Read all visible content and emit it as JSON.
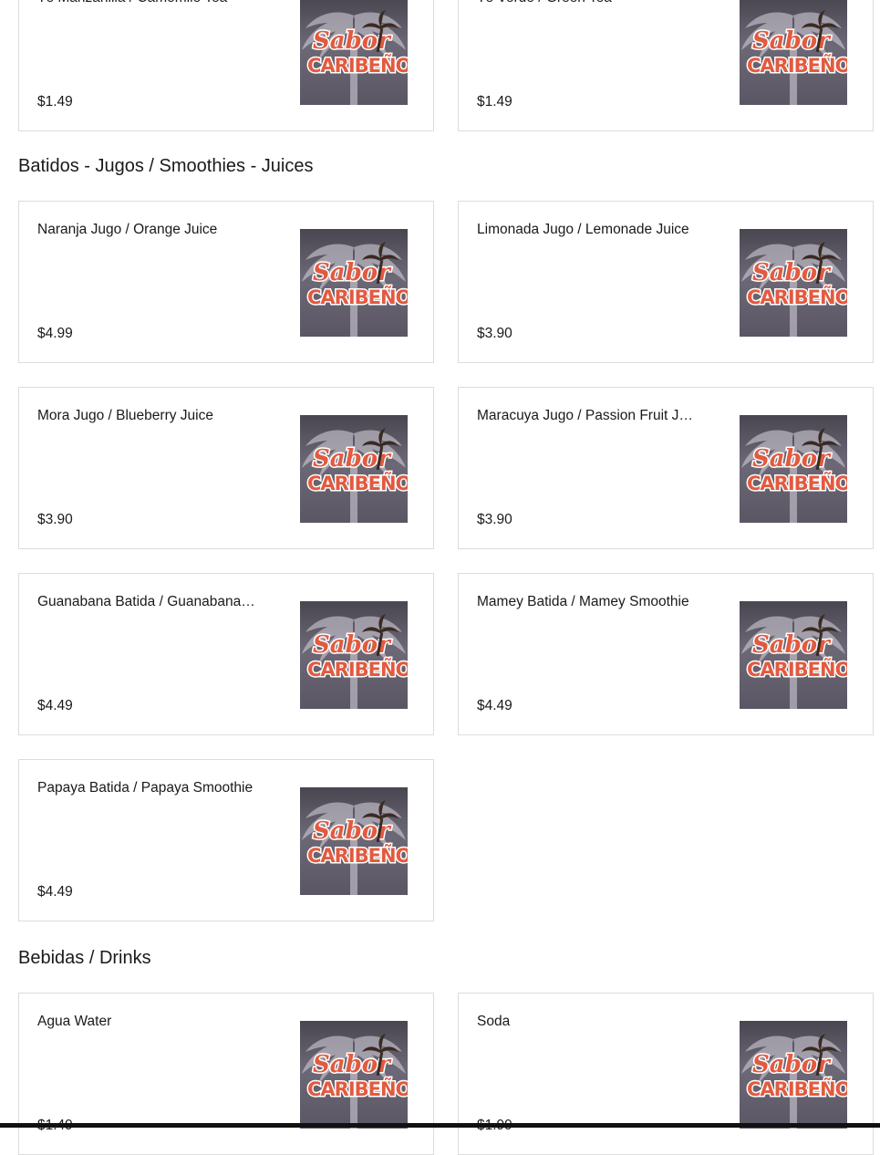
{
  "sections": [
    {
      "title": "",
      "items": [
        {
          "name": "Té Manzanilla / Camomile Tea",
          "price": "$1.49"
        },
        {
          "name": "Té Verde / Green Tea",
          "price": "$1.49"
        }
      ]
    },
    {
      "title": "Batidos - Jugos / Smoothies - Juices",
      "items": [
        {
          "name": "Naranja Jugo / Orange Juice",
          "price": "$4.99"
        },
        {
          "name": "Limonada Jugo / Lemonade Juice",
          "price": "$3.90"
        },
        {
          "name": "Mora Jugo / Blueberry Juice",
          "price": "$3.90"
        },
        {
          "name": "Maracuya Jugo / Passion Fruit Juice",
          "price": "$3.90"
        },
        {
          "name": "Guanabana Batida / Guanabana Smoothie",
          "price": "$4.49"
        },
        {
          "name": "Mamey Batida / Mamey Smoothie",
          "price": "$4.49"
        },
        {
          "name": "Papaya Batida / Papaya Smoothie",
          "price": "$4.49"
        }
      ]
    },
    {
      "title": "Bebidas / Drinks",
      "items": [
        {
          "name": "Agua Water",
          "price": "$1.49"
        },
        {
          "name": "Soda",
          "price": "$1.99"
        }
      ]
    }
  ],
  "logo": {
    "line1": "Sabor",
    "line2": "CARIBEÑO",
    "icon": "palm-tree-logo"
  },
  "colors": {
    "logo_red": "#e25a3f",
    "logo_bg": "#5a5663",
    "border": "#dcdcdc"
  }
}
